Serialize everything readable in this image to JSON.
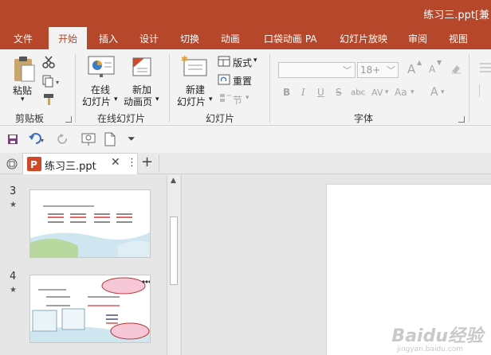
{
  "window": {
    "title": "练习三.ppt[兼"
  },
  "ribbon_tabs": [
    "文件",
    "开始",
    "插入",
    "设计",
    "切换",
    "动画",
    "口袋动画 PA",
    "幻灯片放映",
    "审阅",
    "视图"
  ],
  "active_tab": "开始",
  "clipboard": {
    "paste_label": "粘贴",
    "group_label": "剪贴板"
  },
  "online_slides": {
    "online_slide_label_1": "在线",
    "online_slide_label_2": "幻灯片",
    "new_page_label_1": "新加",
    "new_page_label_2": "动画页",
    "group_label": "在线幻灯片"
  },
  "slides_group": {
    "new_slide_label_1": "新建",
    "new_slide_label_2": "幻灯片",
    "layout_label": "版式",
    "reset_label": "重置",
    "section_label": "节",
    "group_label": "幻灯片"
  },
  "font_group": {
    "font_name": "",
    "font_size": "18+",
    "bold": "B",
    "italic": "I",
    "underline": "U",
    "strike": "S",
    "shadow": "abc",
    "spacing": "AV",
    "case": "Aa",
    "color": "A",
    "grow": "A",
    "shrink": "A",
    "group_label": "字体"
  },
  "document_tab": {
    "name": "练习三.ppt",
    "add": "+"
  },
  "slides": [
    {
      "number": "3",
      "marker": "★"
    },
    {
      "number": "4",
      "marker": "★"
    }
  ],
  "watermark": {
    "text": "Baidu经验",
    "sub": "jingyan.baidu.com"
  },
  "colors": {
    "accent": "#b7472a",
    "ribbon_bg": "#f3f3f3"
  }
}
